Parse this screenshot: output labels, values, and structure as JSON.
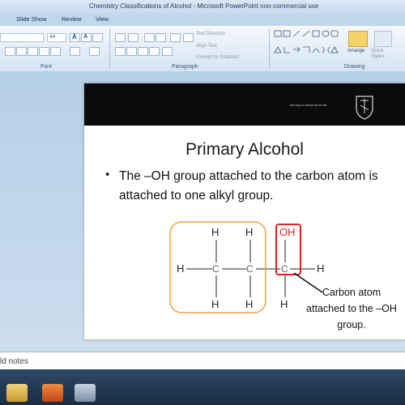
{
  "window": {
    "title": "Chemistry Classifications of Alcohol - Microsoft PowerPoint non-commercial use"
  },
  "ribbon": {
    "tabs": [
      "Slide Show",
      "Review",
      "View"
    ],
    "font_size_value": "44",
    "groups": {
      "font": "Font",
      "paragraph": "Paragraph",
      "drawing": "Drawing"
    },
    "paragraph_commands": {
      "text_direction": "Text Direction",
      "align_text": "Align Text",
      "convert_smartart": "Convert to SmartArt"
    },
    "drawing_commands": {
      "arrange": "Arrange",
      "quick_styles": "Quick Styles"
    }
  },
  "slide": {
    "header_tagline": "Not only for school but for life.",
    "title": "Primary Alcohol",
    "bullet": "The –OH group attached to the carbon atom is\nattached to one alkyl group.",
    "diagram": {
      "atoms": {
        "oh_label": "OH",
        "h": "H",
        "c": "C"
      },
      "callout": [
        "Carbon atom",
        "attached to the –OH",
        "group."
      ],
      "colors": {
        "alkyl_box": "#f0a040",
        "oh_box": "#e02020",
        "oh_text": "#e02020"
      }
    }
  },
  "notes": {
    "text": "ld notes"
  },
  "taskbar": {
    "icons": [
      "explorer-icon",
      "powerpoint-icon",
      "media-icon"
    ]
  }
}
